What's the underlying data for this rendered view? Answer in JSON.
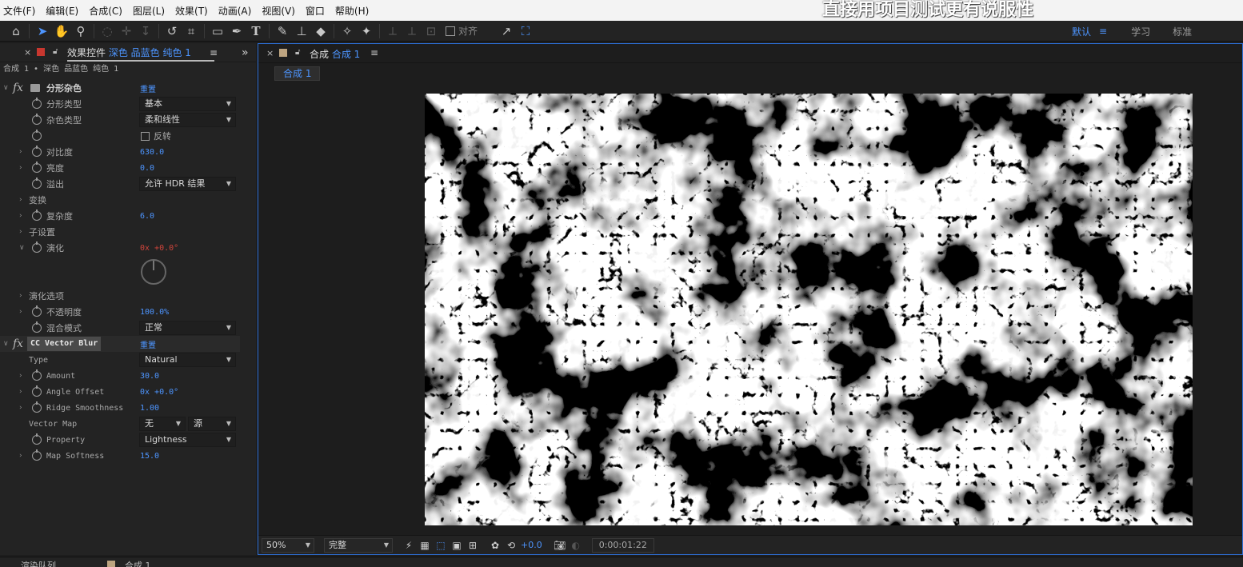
{
  "menu": {
    "items": [
      "文件(F)",
      "编辑(E)",
      "合成(C)",
      "图层(L)",
      "效果(T)",
      "动画(A)",
      "视图(V)",
      "窗口",
      "帮助(H)"
    ],
    "overlay_text": "直接用项目测试更有说服性"
  },
  "toolbar": {
    "align_label": "对齐",
    "workspaces": [
      "默认",
      "学习",
      "标准"
    ],
    "workspace_menu": "≡"
  },
  "effect_controls": {
    "tab_title_prefix": "效果控件",
    "tab_title_layer": "深色 品蓝色 纯色 1",
    "menu_icon": "≡",
    "collapse_icon": "»",
    "subtitle": "合成 1 • 深色 品蓝色 纯色 1",
    "fractal": {
      "name": "分形杂色",
      "reset": "重置",
      "fractal_type_label": "分形类型",
      "fractal_type_value": "基本",
      "noise_type_label": "杂色类型",
      "noise_type_value": "柔和线性",
      "invert_label": "反转",
      "contrast_label": "对比度",
      "contrast_value": "630.0",
      "brightness_label": "亮度",
      "brightness_value": "0.0",
      "overflow_label": "溢出",
      "overflow_value": "允许 HDR 结果",
      "transform_label": "变换",
      "complexity_label": "复杂度",
      "complexity_value": "6.0",
      "sub_settings_label": "子设置",
      "evolution_label": "演化",
      "evolution_value": "0x +0.0°",
      "evolution_options_label": "演化选项",
      "opacity_label": "不透明度",
      "opacity_value": "100.0%",
      "blend_mode_label": "混合模式",
      "blend_mode_value": "正常"
    },
    "vector_blur": {
      "name": "CC Vector Blur",
      "reset": "重置",
      "type_label": "Type",
      "type_value": "Natural",
      "amount_label": "Amount",
      "amount_value": "30.0",
      "angle_offset_label": "Angle Offset",
      "angle_offset_value": "0x +0.0°",
      "ridge_smoothness_label": "Ridge Smoothness",
      "ridge_smoothness_value": "1.00",
      "vector_map_label": "Vector Map",
      "vector_map_value": "无",
      "vector_map_source": "源",
      "property_label": "Property",
      "property_value": "Lightness",
      "map_softness_label": "Map Softness",
      "map_softness_value": "15.0"
    }
  },
  "composition": {
    "tab_title_prefix": "合成",
    "tab_title_name": "合成 1",
    "menu_icon": "≡",
    "breadcrumb": "合成 1",
    "zoom": "50%",
    "resolution": "完整",
    "exposure": "+0.0",
    "timecode": "0:00:01:22"
  },
  "bottom": {
    "render_queue": "渲染队列",
    "comp_tab": "合成 1"
  },
  "colors": {
    "accent": "#4d95ff",
    "keyframe_red": "#d0443b",
    "solid_swatch": "#c8372f",
    "comp_swatch": "#bda480"
  },
  "icons": [
    "home-icon",
    "selection-tool-icon",
    "hand-tool-icon",
    "zoom-tool-icon",
    "rotate-icon",
    "camera-icon",
    "rectangle-tool-icon",
    "pen-tool-icon",
    "type-tool-icon",
    "brush-icon",
    "stamp-icon",
    "eraser-icon",
    "puppet-icon",
    "pin-icon",
    "snapshot-icon"
  ]
}
